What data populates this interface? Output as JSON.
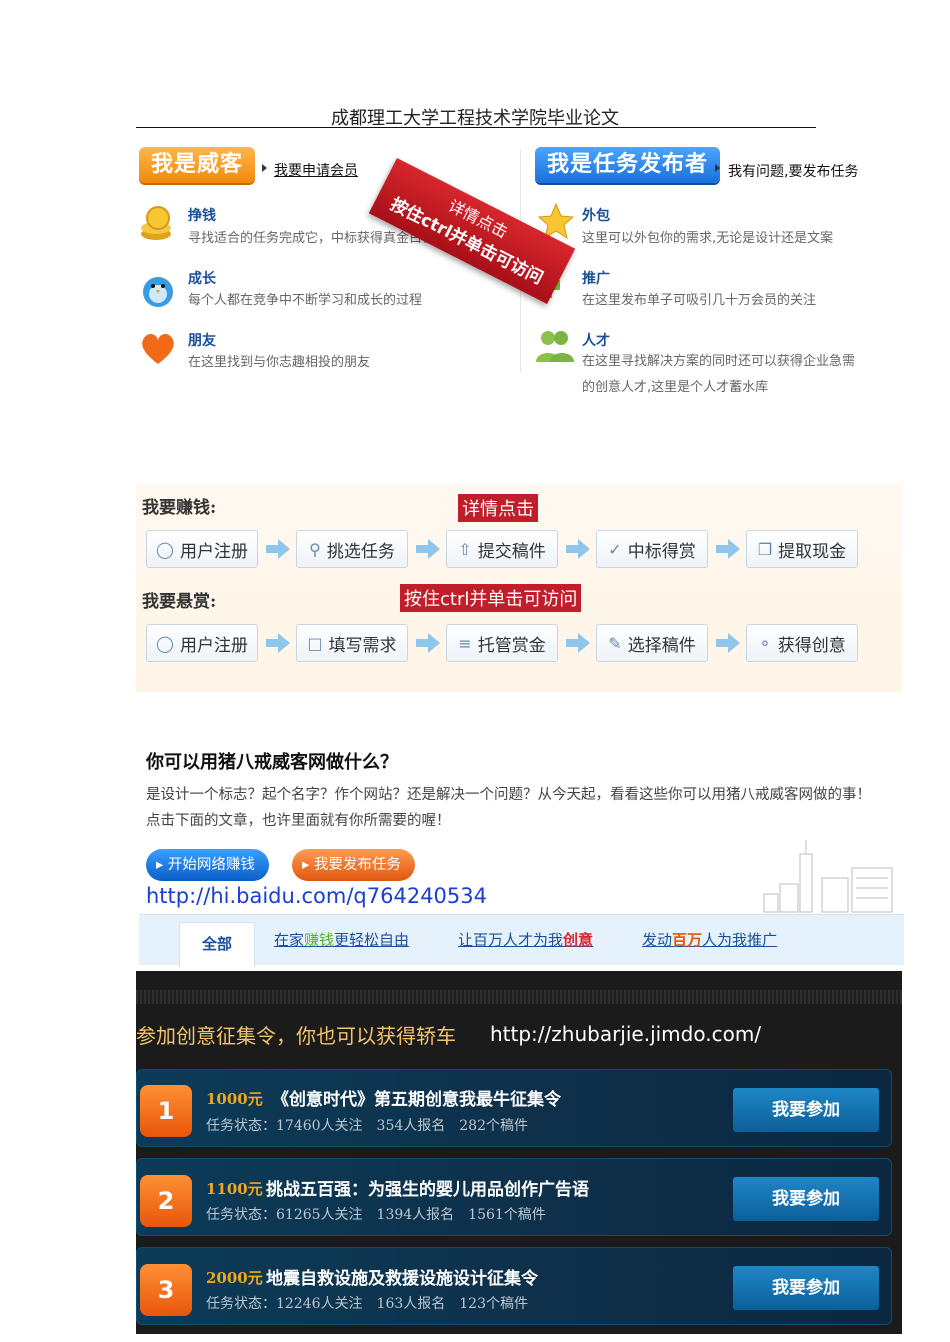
{
  "header": {
    "title": "成都理工大学工程技术学院毕业论文"
  },
  "witkey": {
    "badge": "我是威客",
    "link": "我要申请会员",
    "items": [
      {
        "title": "挣钱",
        "desc": "寻找适合的任务完成它，中标获得真金白银"
      },
      {
        "title": "成长",
        "desc": "每个人都在竞争中不断学习和成长的过程"
      },
      {
        "title": "朋友",
        "desc": "在这里找到与你志趣相投的朋友"
      }
    ]
  },
  "publisher": {
    "badge": "我是任务发布者",
    "link": "我有问题,要发布任务",
    "items": [
      {
        "title": "外包",
        "desc": "这里可以外包你的需求,无论是设计还是文案"
      },
      {
        "title": "推广",
        "desc": "在这里发布单子可吸引几十万会员的关注"
      },
      {
        "title": "人才",
        "desc": "在这里寻找解决方案的同时还可以获得企业急需",
        "desc2": "的创意人才,这里是个人才蓄水库"
      }
    ]
  },
  "ribbon": {
    "line1": "详情点击",
    "line2": "按住ctrl并单击可访问"
  },
  "flow": {
    "earn_heading": "我要赚钱:",
    "earn_steps": [
      "用户注册",
      "挑选任务",
      "提交稿件",
      "中标得赏",
      "提取现金"
    ],
    "reward_heading": "我要悬赏:",
    "reward_steps": [
      "用户注册",
      "填写需求",
      "托管赏金",
      "选择稿件",
      "获得创意"
    ],
    "label_detail": "详情点击",
    "label_ctrl": "按住ctrl并单击可访问"
  },
  "intro": {
    "title": "你可以用猪八戒威客网做什么？",
    "desc": "是设计一个标志？起个名字？作个网站？还是解决一个问题？从今天起，看看这些你可以用猪八戒威客网做的事！点击下面的文章，也许里面就有你所需要的喔！",
    "btn_earn": "开始网络赚钱",
    "btn_post": "我要发布任务",
    "url": "http://hi.baidu.com/q764240534",
    "tabs": {
      "all": "全部",
      "t1_a": "在家",
      "t1_b": "赚钱",
      "t1_c": "更轻松自由",
      "t2_a": "让百万人才为我",
      "t2_b": "创意",
      "t3_a": "发动",
      "t3_b": "百万",
      "t3_c": "人为我推广"
    }
  },
  "contest": {
    "banner": "参加创意征集令，你也可以获得轿车",
    "url": "http://zhubarjie.jimdo.com/",
    "join_label": "我要参加",
    "rows": [
      {
        "rank": "1",
        "prize": "1000元",
        "title": "《创意时代》第五期创意我最牛征集令",
        "status": "任务状态：17460人关注　354人报名　282个稿件"
      },
      {
        "rank": "2",
        "prize": "1100元",
        "title": "挑战五百强：为强生的婴儿用品创作广告语",
        "status": "任务状态：61265人关注　1394人报名　1561个稿件"
      },
      {
        "rank": "3",
        "prize": "2000元",
        "title": "地震自救设施及救援设施设计征集令",
        "status": "任务状态：12246人关注　163人报名　123个稿件"
      }
    ]
  },
  "colors": {
    "accent_orange": "#f08a0a",
    "accent_blue": "#1a6fd8",
    "ribbon_red": "#c01e2a",
    "link_blue": "#1a4f9c"
  }
}
